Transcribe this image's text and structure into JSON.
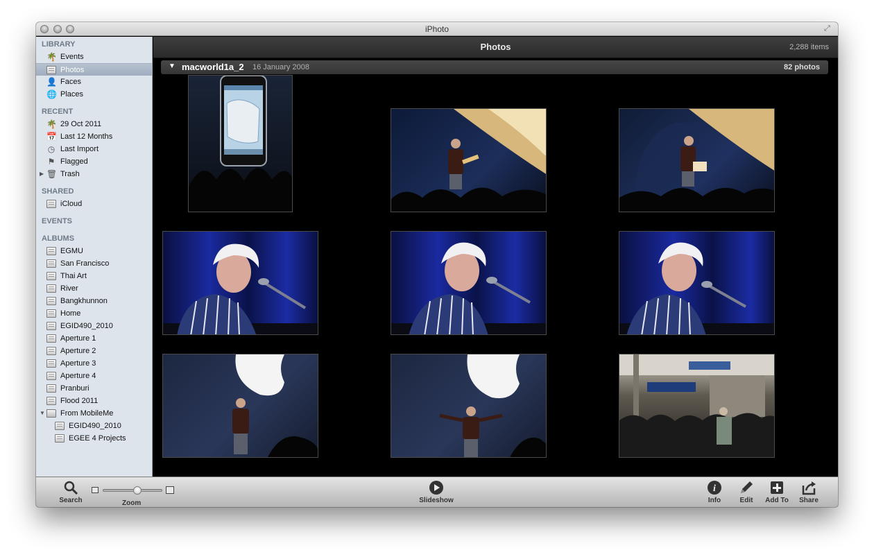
{
  "window": {
    "title": "iPhoto"
  },
  "sidebar": {
    "sections": {
      "library": "LIBRARY",
      "recent": "RECENT",
      "shared": "SHARED",
      "events": "EVENTS",
      "albums": "ALBUMS"
    },
    "library_items": [
      "Events",
      "Photos",
      "Faces",
      "Places"
    ],
    "recent_items": [
      "29 Oct 2011",
      "Last 12 Months",
      "Last Import",
      "Flagged",
      "Trash"
    ],
    "shared_items": [
      "iCloud"
    ],
    "album_items": [
      "EGMU",
      "San Francisco",
      "Thai Art",
      "River",
      "Bangkhunnon",
      "Home",
      "EGID490_2010",
      "Aperture 1",
      "Aperture 2",
      "Aperture 3",
      "Aperture 4",
      "Pranburi",
      "Flood 2011",
      "From MobileMe"
    ],
    "mobileme_children": [
      "EGID490_2010",
      "EGEE 4 Projects"
    ],
    "selected": "Photos"
  },
  "content": {
    "title": "Photos",
    "item_count": "2,288 items",
    "event": {
      "name": "macworld1a_2",
      "date": "16 January 2008",
      "photo_count": "82 photos"
    }
  },
  "toolbar": {
    "search": "Search",
    "zoom": "Zoom",
    "zoom_level": 0.6,
    "slideshow": "Slideshow",
    "info": "Info",
    "edit": "Edit",
    "add_to": "Add To",
    "share": "Share"
  },
  "colors": {
    "sidebar_bg": "#dde4ec",
    "selection": "#a6b3c4",
    "content_bg": "#000000"
  }
}
